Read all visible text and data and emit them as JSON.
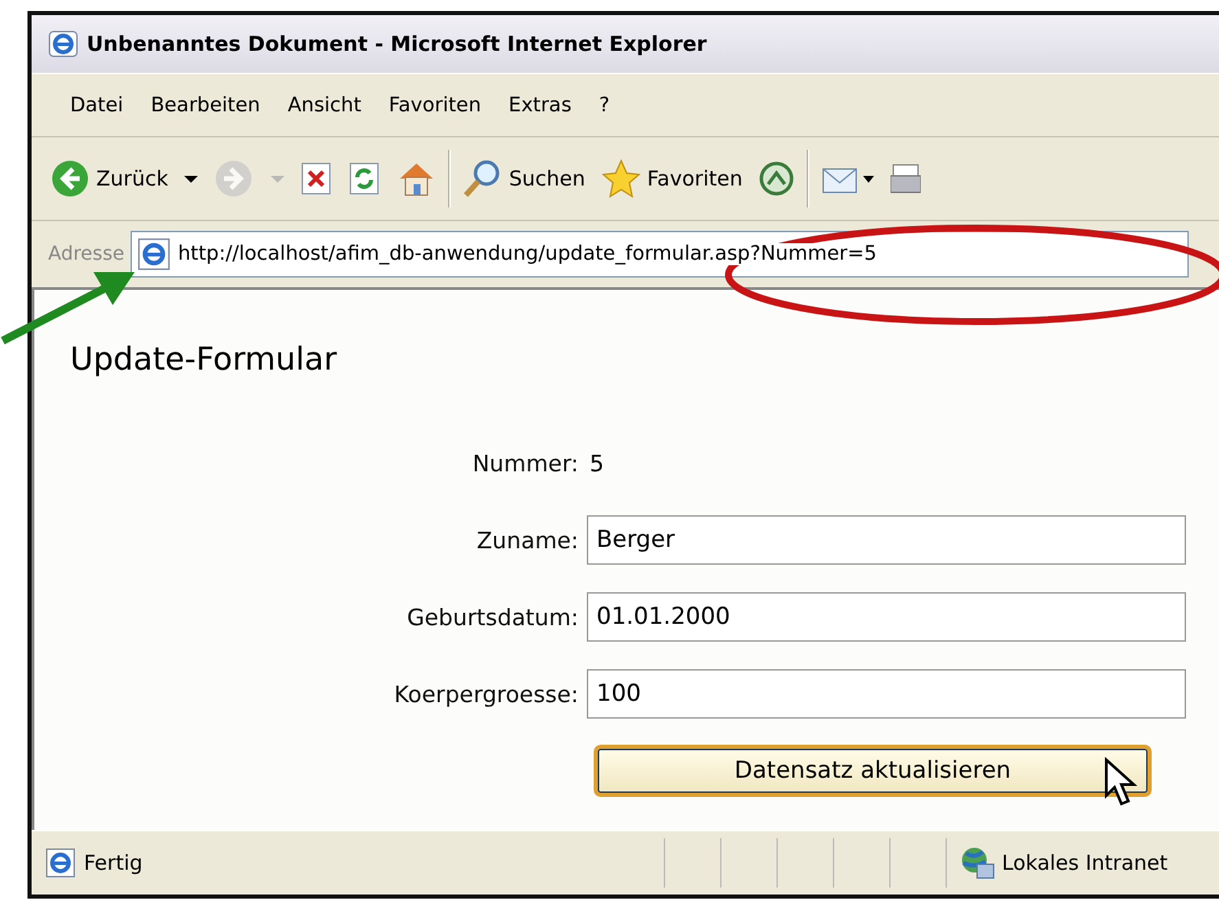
{
  "window": {
    "title": "Unbenanntes Dokument - Microsoft Internet Explorer"
  },
  "menu": [
    "Datei",
    "Bearbeiten",
    "Ansicht",
    "Favoriten",
    "Extras",
    "?"
  ],
  "toolbar": [
    {
      "kind": "back",
      "label": "Zurück",
      "disabled": false
    },
    {
      "kind": "forward",
      "disabled": true
    },
    {
      "kind": "stop"
    },
    {
      "kind": "refresh"
    },
    {
      "kind": "home"
    },
    {
      "kind": "separator"
    },
    {
      "kind": "search",
      "label": "Suchen"
    },
    {
      "kind": "favorites",
      "label": "Favoriten"
    },
    {
      "kind": "media"
    },
    {
      "kind": "separator"
    },
    {
      "kind": "mail"
    },
    {
      "kind": "print"
    }
  ],
  "address": {
    "label": "Adresse",
    "url": "http://localhost/afim_db-anwendung/update_formular.asp?Nummer=5"
  },
  "page": {
    "heading": "Update-Formular",
    "fields": [
      {
        "kind": "text",
        "label": "Nummer:",
        "value": "5"
      },
      {
        "kind": "input",
        "label": "Zuname:",
        "value": "Berger"
      },
      {
        "kind": "input",
        "label": "Geburtsdatum:",
        "value": "01.01.2000"
      },
      {
        "kind": "input",
        "label": "Koerpergroesse:",
        "value": "100"
      }
    ],
    "button": "Datensatz aktualisieren"
  },
  "status_bar": {
    "text": "Fertig",
    "zone": "Lokales Intranet"
  }
}
